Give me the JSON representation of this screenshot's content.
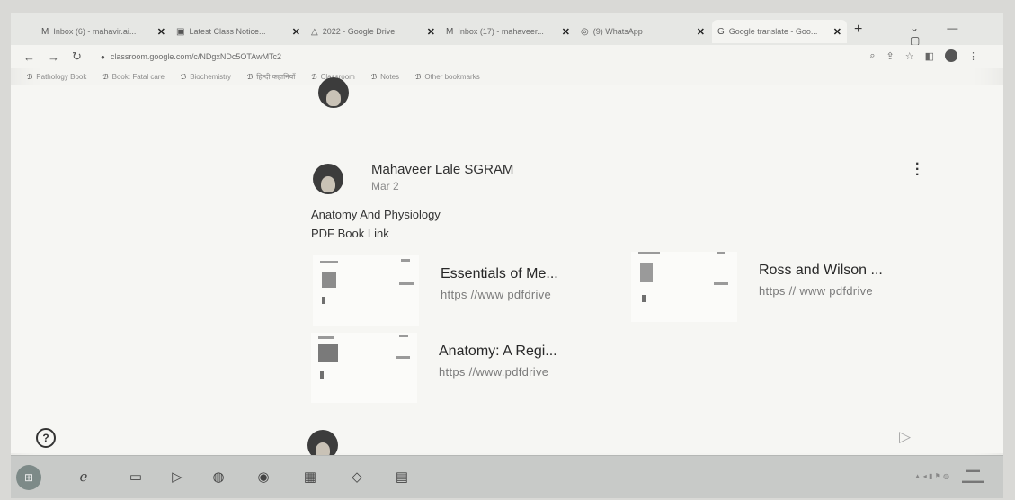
{
  "browser": {
    "tabs": [
      {
        "icon": "gmail-icon",
        "label": "Inbox (6) - mahavir.ai..."
      },
      {
        "icon": "class-icon",
        "label": "Latest Class Notice..."
      },
      {
        "icon": "drive-icon",
        "label": "2022 - Google Drive"
      },
      {
        "icon": "gmail-icon",
        "label": "Inbox (17) - mahaveer..."
      },
      {
        "icon": "whatsapp-icon",
        "label": "(9) WhatsApp"
      },
      {
        "icon": "google-icon",
        "label": "Google translate - Goo..."
      }
    ],
    "active_tab": 5,
    "url": "classroom.google.com/c/NDgxNDc5OTAwMTc2"
  },
  "bookmarks": [
    {
      "icon": "book-icon",
      "label": "Pathology Book"
    },
    {
      "icon": "book-icon",
      "label": "Book: Fatal care"
    },
    {
      "icon": "book-icon",
      "label": "Biochemistry"
    },
    {
      "icon": "book-icon",
      "label": "हिन्दी कहानियाँ"
    },
    {
      "icon": "book-icon",
      "label": "Classroom"
    },
    {
      "icon": "book-icon",
      "label": "Notes"
    },
    {
      "icon": "book-icon",
      "label": "Other bookmarks"
    }
  ],
  "post": {
    "author": "Mahaveer Lale SGRAM",
    "date": "Mar 2",
    "text_line1": "Anatomy And Physiology",
    "text_line2": "PDF Book Link",
    "attachments": [
      {
        "title": "Essentials of Me...",
        "url": "https //www pdfdrive"
      },
      {
        "title": "Ross and Wilson ...",
        "url": "https // www pdfdrive"
      },
      {
        "title": "Anatomy: A Regi...",
        "url": "https //www.pdfdrive"
      }
    ]
  },
  "help_label": "?",
  "colors": {
    "page": "#f6f6f3",
    "text": "#303030",
    "muted": "#7a7a7a",
    "send": "#a8a8a8"
  }
}
